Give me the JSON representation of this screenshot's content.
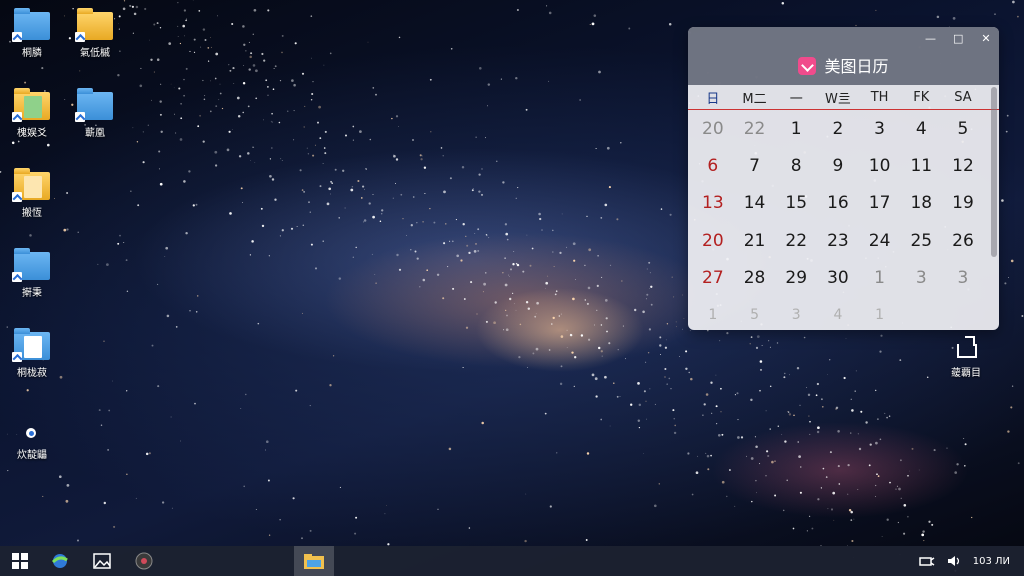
{
  "desktop": {
    "icons": [
      {
        "label": "桐膦",
        "icon": "folder-blue-icon"
      },
      {
        "label": "氣低槭",
        "icon": "folder-yellow-icon"
      },
      {
        "label": "槐娱爻",
        "icon": "image-folder-icon"
      },
      {
        "label": "蘄凰",
        "icon": "folder-blue-icon"
      },
      {
        "label": "搬恆",
        "icon": "image-file-icon"
      },
      {
        "label": "搟秉",
        "icon": "folder-blue-icon"
      },
      {
        "label": "桐栊菽",
        "icon": "document-folder-icon"
      },
      {
        "label": "炊靛鼺",
        "icon": "app-shortcut-icon"
      }
    ],
    "right_icon": {
      "label": "藧覇目",
      "icon": "note-icon"
    }
  },
  "calendar": {
    "title": "美图日历",
    "controls": {
      "minimize": "—",
      "maximize": "□",
      "close": "✕"
    },
    "weekdays": [
      "日",
      "M二",
      "一",
      "W亖",
      "TH",
      "FK",
      "SA"
    ],
    "rows": [
      [
        "20",
        "22",
        "1",
        "2",
        "3",
        "4",
        "5"
      ],
      [
        "6",
        "7",
        "8",
        "9",
        "10",
        "11",
        "12"
      ],
      [
        "13",
        "14",
        "15",
        "16",
        "17",
        "18",
        "19"
      ],
      [
        "20",
        "21",
        "22",
        "23",
        "24",
        "25",
        "26"
      ],
      [
        "27",
        "28",
        "29",
        "30",
        "1",
        "3",
        "3"
      ],
      [
        "1",
        "5",
        "3",
        "4",
        "1",
        "",
        ""
      ]
    ],
    "accent": "#f04b8c"
  },
  "taskbar": {
    "items": [
      "start-icon",
      "browser-icon",
      "photos-icon",
      "media-icon",
      "file-explorer-icon"
    ],
    "tray": {
      "clock": "103 ЛИ"
    }
  }
}
